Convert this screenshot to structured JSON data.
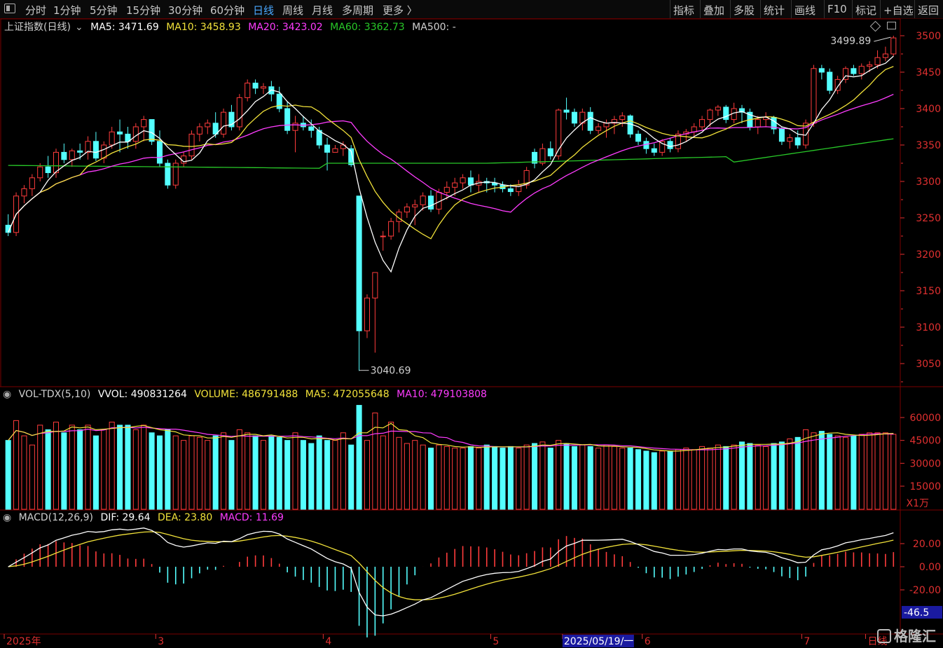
{
  "toolbar": {
    "left_items": [
      "分时",
      "1分钟",
      "5分钟",
      "15分钟",
      "30分钟",
      "60分钟",
      "日线",
      "周线",
      "月线",
      "多周期",
      "更多 〉"
    ],
    "active": "日线",
    "right_items": [
      "指标",
      "叠加",
      "多股",
      "统计",
      "画线",
      "F10",
      "标记",
      "+自选",
      "返回"
    ]
  },
  "price_header": {
    "title": "上证指数(日线)",
    "ma5": "MA5: 3471.69",
    "ma10": "MA10: 3458.93",
    "ma20": "MA20: 3423.02",
    "ma60": "MA60: 3362.73",
    "ma500": "MA500: -"
  },
  "volume_header": {
    "title": "VOL-TDX(5,10)",
    "vvol": "VVOL: 490831264",
    "volume": "VOLUME: 486791488",
    "ma5": "MA5: 472055648",
    "ma10": "MA10: 479103808"
  },
  "macd_header": {
    "title": "MACD(12,26,9)",
    "dif": "DIF: 29.64",
    "dea": "DEA: 23.80",
    "macd": "MACD: 11.69"
  },
  "colors": {
    "up": "#ff3c3c",
    "down": "#54ffff",
    "ma5": "#ffffff",
    "ma10": "#f2e23a",
    "ma20": "#ff3cff",
    "ma60": "#28c828",
    "axis": "#e03030"
  },
  "watermark": "格隆汇",
  "chart_data": {
    "type": "candlestick",
    "instrument": "上证指数",
    "annotations": {
      "high": "3499.89",
      "low": "3040.69"
    },
    "price_axis": {
      "ticks": [
        3050,
        3100,
        3150,
        3200,
        3250,
        3300,
        3350,
        3400,
        3450,
        3500
      ]
    },
    "volume_axis": {
      "ticks": [
        15000,
        30000,
        45000,
        60000
      ],
      "unit_label": "X1万"
    },
    "macd_axis": {
      "ticks": [
        -20,
        0,
        20
      ],
      "tick_labels": [
        "-20.00",
        "0.00",
        "20.00"
      ],
      "current_label": "-46.5"
    },
    "x_labels": [
      {
        "index": 0,
        "text": "2025年"
      },
      {
        "index": 19,
        "text": "3"
      },
      {
        "index": 40,
        "text": "4"
      },
      {
        "index": 61,
        "text": "5"
      },
      {
        "index": 70,
        "text": "2025/05/19/一"
      },
      {
        "index": 80,
        "text": "6"
      },
      {
        "index": 100,
        "text": "7"
      },
      {
        "index": 108,
        "text": "日线"
      }
    ],
    "candles": [
      [
        3240,
        3255,
        3225,
        3230
      ],
      [
        3230,
        3285,
        3225,
        3280
      ],
      [
        3280,
        3295,
        3270,
        3290
      ],
      [
        3290,
        3310,
        3280,
        3305
      ],
      [
        3305,
        3325,
        3300,
        3320
      ],
      [
        3320,
        3335,
        3305,
        3312
      ],
      [
        3312,
        3345,
        3305,
        3340
      ],
      [
        3340,
        3352,
        3325,
        3330
      ],
      [
        3330,
        3345,
        3320,
        3342
      ],
      [
        3342,
        3352,
        3330,
        3340
      ],
      [
        3340,
        3362,
        3330,
        3355
      ],
      [
        3355,
        3368,
        3328,
        3332
      ],
      [
        3332,
        3355,
        3325,
        3350
      ],
      [
        3350,
        3375,
        3345,
        3368
      ],
      [
        3368,
        3385,
        3340,
        3365
      ],
      [
        3365,
        3375,
        3345,
        3355
      ],
      [
        3355,
        3380,
        3345,
        3375
      ],
      [
        3375,
        3390,
        3355,
        3385
      ],
      [
        3385,
        3385,
        3350,
        3355
      ],
      [
        3355,
        3370,
        3320,
        3325
      ],
      [
        3325,
        3330,
        3290,
        3295
      ],
      [
        3295,
        3330,
        3290,
        3325
      ],
      [
        3325,
        3340,
        3320,
        3335
      ],
      [
        3335,
        3370,
        3330,
        3365
      ],
      [
        3365,
        3380,
        3355,
        3375
      ],
      [
        3375,
        3385,
        3365,
        3380
      ],
      [
        3380,
        3395,
        3360,
        3365
      ],
      [
        3365,
        3400,
        3360,
        3395
      ],
      [
        3395,
        3405,
        3370,
        3375
      ],
      [
        3375,
        3420,
        3370,
        3415
      ],
      [
        3415,
        3440,
        3410,
        3435
      ],
      [
        3435,
        3440,
        3420,
        3428
      ],
      [
        3428,
        3435,
        3420,
        3430
      ],
      [
        3430,
        3438,
        3410,
        3420
      ],
      [
        3420,
        3430,
        3395,
        3400
      ],
      [
        3400,
        3410,
        3365,
        3370
      ],
      [
        3370,
        3390,
        3340,
        3380
      ],
      [
        3380,
        3390,
        3370,
        3375
      ],
      [
        3375,
        3385,
        3360,
        3370
      ],
      [
        3370,
        3375,
        3345,
        3350
      ],
      [
        3350,
        3360,
        3315,
        3340
      ],
      [
        3340,
        3350,
        3340,
        3345
      ],
      [
        3345,
        3355,
        3335,
        3350
      ],
      [
        3345,
        3350,
        3320,
        3323
      ],
      [
        3280,
        3215,
        3040,
        3095
      ],
      [
        3095,
        3145,
        3085,
        3140
      ],
      [
        3140,
        3175,
        3065,
        3175
      ],
      [
        3225,
        3232,
        3205,
        3225
      ],
      [
        3225,
        3250,
        3220,
        3245
      ],
      [
        3245,
        3262,
        3230,
        3258
      ],
      [
        3258,
        3270,
        3250,
        3265
      ],
      [
        3265,
        3275,
        3240,
        3268
      ],
      [
        3268,
        3285,
        3260,
        3280
      ],
      [
        3280,
        3288,
        3258,
        3262
      ],
      [
        3262,
        3290,
        3255,
        3285
      ],
      [
        3285,
        3300,
        3275,
        3292
      ],
      [
        3292,
        3305,
        3280,
        3298
      ],
      [
        3298,
        3310,
        3290,
        3305
      ],
      [
        3305,
        3315,
        3285,
        3295
      ],
      [
        3295,
        3310,
        3285,
        3300
      ],
      [
        3300,
        3305,
        3285,
        3298
      ],
      [
        3298,
        3305,
        3285,
        3295
      ],
      [
        3295,
        3300,
        3285,
        3290
      ],
      [
        3290,
        3296,
        3280,
        3286
      ],
      [
        3286,
        3302,
        3280,
        3295
      ],
      [
        3295,
        3320,
        3290,
        3315
      ],
      [
        3340,
        3345,
        3318,
        3325
      ],
      [
        3325,
        3352,
        3322,
        3345
      ],
      [
        3345,
        3355,
        3330,
        3335
      ],
      [
        3335,
        3400,
        3330,
        3398
      ],
      [
        3398,
        3415,
        3385,
        3395
      ],
      [
        3395,
        3400,
        3375,
        3380
      ],
      [
        3380,
        3400,
        3370,
        3395
      ],
      [
        3395,
        3402,
        3365,
        3370
      ],
      [
        3370,
        3380,
        3365,
        3375
      ],
      [
        3375,
        3385,
        3360,
        3380
      ],
      [
        3380,
        3390,
        3365,
        3385
      ],
      [
        3385,
        3395,
        3375,
        3390
      ],
      [
        3390,
        3392,
        3360,
        3365
      ],
      [
        3365,
        3370,
        3350,
        3355
      ],
      [
        3355,
        3360,
        3338,
        3345
      ],
      [
        3345,
        3352,
        3335,
        3340
      ],
      [
        3340,
        3358,
        3335,
        3355
      ],
      [
        3355,
        3360,
        3340,
        3345
      ],
      [
        3345,
        3370,
        3340,
        3365
      ],
      [
        3365,
        3372,
        3355,
        3368
      ],
      [
        3368,
        3380,
        3360,
        3375
      ],
      [
        3375,
        3390,
        3370,
        3385
      ],
      [
        3385,
        3400,
        3375,
        3398
      ],
      [
        3398,
        3405,
        3390,
        3402
      ],
      [
        3402,
        3405,
        3380,
        3385
      ],
      [
        3385,
        3408,
        3380,
        3400
      ],
      [
        3400,
        3405,
        3380,
        3395
      ],
      [
        3395,
        3400,
        3370,
        3375
      ],
      [
        3375,
        3390,
        3365,
        3385
      ],
      [
        3385,
        3395,
        3375,
        3388
      ],
      [
        3388,
        3390,
        3365,
        3372
      ],
      [
        3372,
        3375,
        3350,
        3355
      ],
      [
        3355,
        3365,
        3345,
        3360
      ],
      [
        3360,
        3370,
        3345,
        3350
      ],
      [
        3350,
        3385,
        3345,
        3380
      ],
      [
        3380,
        3460,
        3375,
        3455
      ],
      [
        3455,
        3460,
        3440,
        3450
      ],
      [
        3450,
        3455,
        3420,
        3425
      ],
      [
        3425,
        3445,
        3420,
        3440
      ],
      [
        3440,
        3458,
        3435,
        3455
      ],
      [
        3455,
        3460,
        3445,
        3448
      ],
      [
        3448,
        3462,
        3440,
        3458
      ],
      [
        3458,
        3465,
        3450,
        3460
      ],
      [
        3460,
        3480,
        3455,
        3470
      ],
      [
        3470,
        3485,
        3465,
        3475
      ],
      [
        3475,
        3500,
        3472,
        3497
      ]
    ],
    "volume": [
      45,
      58,
      48,
      42,
      55,
      52,
      57,
      50,
      55,
      52,
      55,
      48,
      52,
      57,
      55,
      55,
      52,
      55,
      50,
      48,
      52,
      48,
      45,
      48,
      47,
      45,
      48,
      50,
      45,
      52,
      50,
      48,
      45,
      48,
      47,
      45,
      50,
      45,
      43,
      48,
      45,
      45,
      50,
      42,
      68,
      45,
      63,
      48,
      57,
      47,
      43,
      45,
      42,
      40,
      42,
      41,
      40,
      40,
      41,
      40,
      42,
      41,
      40,
      41,
      40,
      42,
      43,
      44,
      40,
      45,
      43,
      41,
      42,
      41,
      40,
      42,
      41,
      40,
      40,
      39,
      38,
      37,
      38,
      38,
      39,
      40,
      39,
      41,
      40,
      42,
      41,
      42,
      44,
      43,
      42,
      41,
      43,
      44,
      46,
      47,
      52,
      50,
      51,
      49,
      48,
      47,
      48,
      49,
      50,
      50,
      50,
      49
    ],
    "ma_values": {
      "MA5": 3471.69,
      "MA10": 3458.93,
      "MA20": 3423.02,
      "MA60": 3362.73
    },
    "macd_values": {
      "DIF": 29.64,
      "DEA": 23.8,
      "MACD": 11.69
    }
  }
}
